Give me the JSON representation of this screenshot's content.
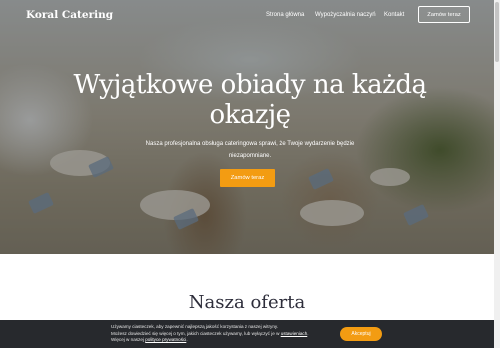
{
  "navbar": {
    "brand": "Koral Catering",
    "links": [
      "Strona główna",
      "Wypożyczalnia naczyń",
      "Kontakt"
    ],
    "cta": "Zamów teraz"
  },
  "hero": {
    "title_line1": "Wyjątkowe obiady na każdą",
    "title_line2": "okazję",
    "subtitle_line1": "Nasza profesjonalna obsługa cateringowa sprawi, że Twoje wydarzenie będzie",
    "subtitle_line2": "niezapomniane.",
    "cta": "Zamów teraz"
  },
  "offer": {
    "title": "Nasza oferta"
  },
  "cookie": {
    "line1": "Używamy ciasteczek, aby zapewnić najlepszą jakość korzystania z naszej witryny.",
    "line2_prefix": "Możesz dowiedzieć się więcej o tym, jakich ciasteczek używamy, lub wyłączyć je w ",
    "line2_link": "ustawieniach",
    "line2_suffix": ".",
    "line3_prefix": "Więcej w naszej ",
    "line3_link": "polityce prywatności",
    "line3_suffix": ".",
    "accept": "Akceptuj"
  },
  "colors": {
    "accent": "#f39c12",
    "cookie_bg": "#27292d",
    "heading": "#2d2d3a"
  }
}
